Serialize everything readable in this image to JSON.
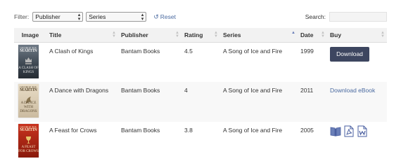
{
  "filter": {
    "label": "Filter:",
    "publisher_select": "Publisher",
    "series_select": "Series",
    "reset_label": "Reset"
  },
  "search": {
    "label": "Search:",
    "value": "",
    "placeholder": ""
  },
  "table": {
    "columns": [
      "Image",
      "Title",
      "Publisher",
      "Rating",
      "Series",
      "Date",
      "Buy"
    ],
    "sorted_column": "Series",
    "rows": [
      {
        "cover": {
          "author": "GEORGE R.R.",
          "author2": "MARTIN",
          "title": "A CLASH OF KINGS",
          "colors": [
            "#6f7a86",
            "#262c33"
          ]
        },
        "title": "A Clash of Kings",
        "publisher": "Bantam Books",
        "rating": "4.5",
        "series": "A Song of Ice and Fire",
        "date": "1999",
        "buy": {
          "type": "button",
          "label": "Download"
        }
      },
      {
        "cover": {
          "author": "GEORGE R.R.",
          "author2": "MARTIN",
          "title": "A DANCE WITH DRAGONS",
          "colors": [
            "#e8dcc6",
            "#cbbba0"
          ]
        },
        "title": "A Dance with Dragons",
        "publisher": "Bantam Books",
        "rating": "4",
        "series": "A Song of Ice and Fire",
        "date": "2011",
        "buy": {
          "type": "link",
          "label": "Download eBook"
        }
      },
      {
        "cover": {
          "author": "GEORGE R.R.",
          "author2": "MARTIN",
          "title": "A FEAST FOR CROWS",
          "colors": [
            "#c8321e",
            "#8a1a0c"
          ]
        },
        "title": "A Feast for Crows",
        "publisher": "Bantam Books",
        "rating": "3.8",
        "series": "A Song of Ice and Fire",
        "date": "2005",
        "buy": {
          "type": "icons",
          "icons": [
            "ebook-icon",
            "pdf-icon",
            "word-doc-icon"
          ]
        }
      }
    ]
  },
  "colors": {
    "accent": "#3d4660",
    "link": "#4a6aa0",
    "header_bg": "#f2f2f2"
  }
}
